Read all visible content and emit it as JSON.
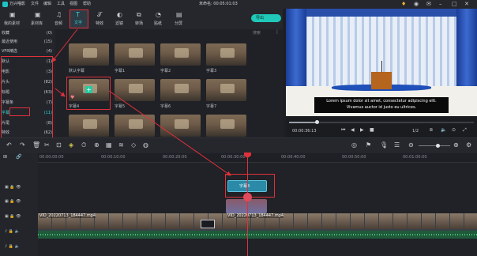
{
  "app": {
    "title": "万兴喵影",
    "menu": [
      "文件",
      "编辑",
      "工具",
      "视图",
      "帮助"
    ],
    "project_title": "未命名: 00:05:01:03",
    "export_label": "导出"
  },
  "toolbar": {
    "tabs": [
      {
        "label": "我的素材",
        "icon": "folder-icon"
      },
      {
        "label": "素材库",
        "icon": "folder-icon"
      },
      {
        "label": "音频",
        "icon": "music-icon"
      },
      {
        "label": "文字",
        "icon": "text-icon"
      },
      {
        "label": "特效",
        "icon": "text-effect-icon"
      },
      {
        "label": "滤镜",
        "icon": "filter-icon"
      },
      {
        "label": "转场",
        "icon": "transition-icon"
      },
      {
        "label": "贴纸",
        "icon": "sticker-icon"
      },
      {
        "label": "分屏",
        "icon": "split-screen-icon"
      }
    ]
  },
  "sidebar": {
    "items": [
      {
        "label": "收藏",
        "count": "(0)"
      },
      {
        "label": "最近使用",
        "count": "(15)"
      },
      {
        "label": "VFR精选",
        "count": "(4)"
      },
      {
        "label": "默认",
        "count": "(1)"
      },
      {
        "label": "电影",
        "count": "(3)"
      },
      {
        "label": "片头",
        "count": "(82)"
      },
      {
        "label": "标题",
        "count": "(63)"
      },
      {
        "label": "字幕条",
        "count": "(7)"
      },
      {
        "label": "字幕",
        "count": "(11)"
      },
      {
        "label": "片尾",
        "count": "(8)"
      },
      {
        "label": "特效",
        "count": "(62)"
      }
    ]
  },
  "grid": {
    "search_placeholder": "搜索",
    "items": [
      {
        "label": "默认字幕"
      },
      {
        "label": "字幕1"
      },
      {
        "label": "字幕2"
      },
      {
        "label": "字幕3"
      },
      {
        "label": "字幕4"
      },
      {
        "label": "字幕5"
      },
      {
        "label": "字幕6"
      },
      {
        "label": "字幕7"
      },
      {
        "label": ""
      },
      {
        "label": ""
      },
      {
        "label": ""
      },
      {
        "label": ""
      }
    ]
  },
  "preview": {
    "subtitle_line1": "Lorem ipsum dolor sit amet, consectetur adipiscing elit.",
    "subtitle_line2": "Vivamus auctor id justo eu ultrices.",
    "timecode": "00:00:36:13",
    "page": "1/2",
    "progress": 0.15
  },
  "timeline": {
    "ruler": [
      "00:00:00:00",
      "00:00:10:00",
      "00:00:20:00",
      "00:00:30:00",
      "00:00:40:00",
      "00:00:50:00",
      "00:01:00:00"
    ],
    "title_clip": "字幕4",
    "video_clip": "VID_20220713_184447.mp4",
    "video_clip_2": "VID_20220713_184447.mp4"
  }
}
